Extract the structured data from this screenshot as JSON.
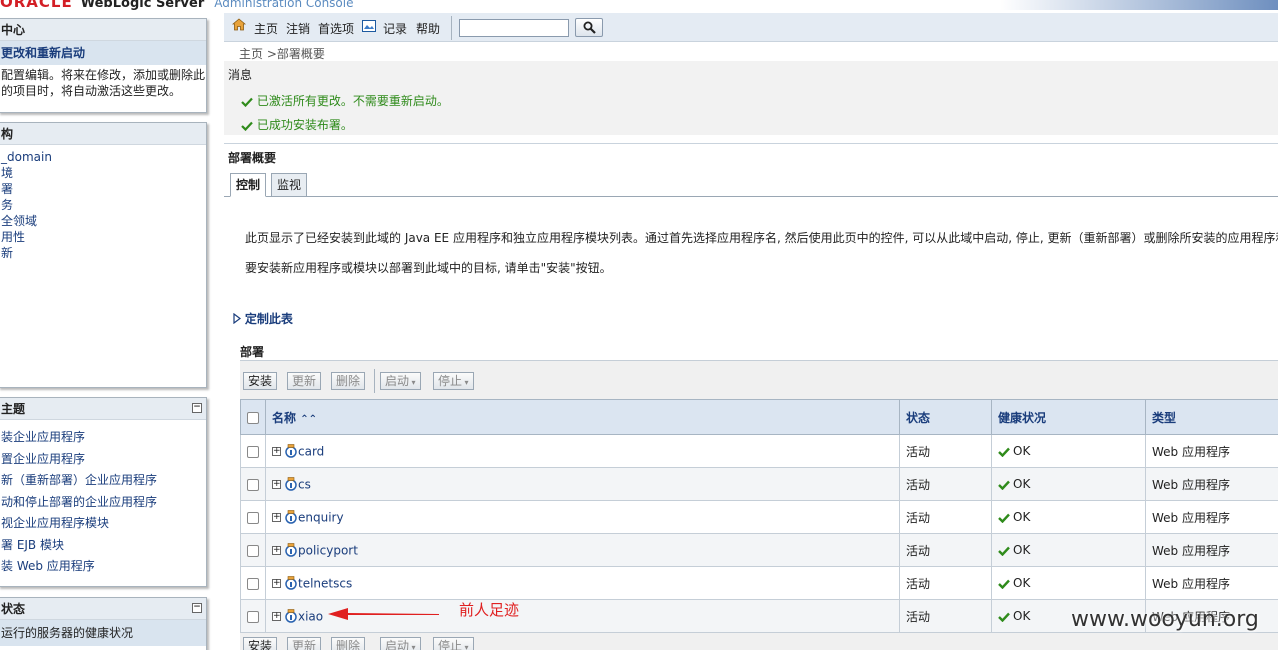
{
  "header": {
    "oracle": "ORACLE",
    "product": "WebLogic Server",
    "console": "Administration Console"
  },
  "toolbar": {
    "home": "主页",
    "logout": "注销",
    "preferences": "首选项",
    "record": "记录",
    "help": "帮助",
    "search_placeholder": ""
  },
  "breadcrumb": {
    "home": "主页",
    "sep": ">",
    "current": "部署概要"
  },
  "messages": {
    "title": "消息",
    "items": [
      "已激活所有更改。不需要重新启动。",
      "已成功安装布署。"
    ]
  },
  "left": {
    "change_center": {
      "title": "中心",
      "link": "更改和重新启动",
      "desc1": "配置编辑。将来在修改，添加或删除此",
      "desc2": "的项目时，将自动激活这些更改。"
    },
    "domain_structure": {
      "title": "构",
      "items": [
        "_domain",
        "境",
        "署",
        "务",
        "全领域",
        "用性",
        "新"
      ]
    },
    "how_do_i": {
      "title": "主题",
      "items": [
        "装企业应用程序",
        "置企业应用程序",
        "新（重新部署）企业应用程序",
        "动和停止部署的企业应用程序",
        "视企业应用程序模块",
        "署 EJB 模块",
        "装 Web 应用程序"
      ]
    },
    "system_status": {
      "title": "状态",
      "item": "运行的服务器的健康状况"
    }
  },
  "overview": {
    "title": "部署概要",
    "tabs": [
      "控制",
      "监视"
    ],
    "desc1": "此页显示了已经安装到此域的 Java EE 应用程序和独立应用程序模块列表。通过首先选择应用程序名, 然后使用此页中的控件, 可以从此域中启动, 停止, 更新（重新部署）或删除所安装的应用程序和",
    "desc2": "要安装新应用程序或模块以部署到此域中的目标, 请单击\"安装\"按钮。",
    "customize": "定制此表",
    "section": "部署",
    "buttons": {
      "install": "安装",
      "update": "更新",
      "delete": "删除",
      "start": "启动",
      "stop": "停止"
    }
  },
  "table": {
    "headers": [
      "名称",
      "状态",
      "健康状况",
      "类型"
    ],
    "rows": [
      {
        "name": "card",
        "state": "活动",
        "health": "OK",
        "type": "Web 应用程序"
      },
      {
        "name": "cs",
        "state": "活动",
        "health": "OK",
        "type": "Web 应用程序"
      },
      {
        "name": "enquiry",
        "state": "活动",
        "health": "OK",
        "type": "Web 应用程序"
      },
      {
        "name": "policyport",
        "state": "活动",
        "health": "OK",
        "type": "Web 应用程序"
      },
      {
        "name": "telnetscs",
        "state": "活动",
        "health": "OK",
        "type": "Web 应用程序"
      },
      {
        "name": "xiao",
        "state": "活动",
        "health": "OK",
        "type": "Web 应用程序"
      }
    ]
  },
  "annotation": {
    "note": "前人足迹",
    "watermark": "www.wooyun.org"
  },
  "colors": {
    "link": "#1a3d7c",
    "success": "#2f8b1b",
    "annotation": "#e02020"
  }
}
